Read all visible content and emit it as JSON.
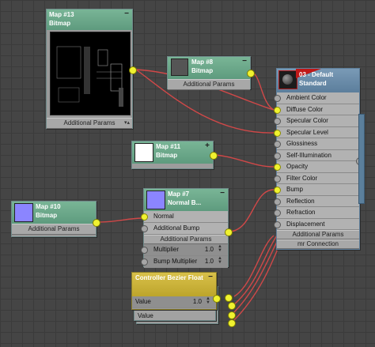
{
  "nodes": {
    "map13": {
      "title": "Map #13",
      "subtitle": "Bitmap",
      "footer": "Additional Params",
      "collapse": "−"
    },
    "map8": {
      "title": "Map #8",
      "subtitle": "Bitmap",
      "footer": "Additional Params",
      "collapse": "−"
    },
    "map11": {
      "title": "Map #11",
      "subtitle": "Bitmap",
      "collapse": "+"
    },
    "map10": {
      "title": "Map #10",
      "subtitle": "Bitmap",
      "footer": "Additional Params"
    },
    "map7": {
      "title": "Map #7",
      "subtitle": "Normal B...",
      "collapse": "−",
      "rows": [
        "Normal",
        "Additional Bump"
      ],
      "section": "Additional Params",
      "params": [
        {
          "label": "Multiplier",
          "value": "1.0"
        },
        {
          "label": "Bump Multiplier",
          "value": "1.0"
        }
      ]
    },
    "standard": {
      "title": "03 - Default",
      "subtitle": "Standard",
      "slots": [
        "Ambient Color",
        "Diffuse Color",
        "Specular Color",
        "Specular Level",
        "Glossiness",
        "Self-Illumination",
        "Opacity",
        "Filter Color",
        "Bump",
        "Reflection",
        "Refraction",
        "Displacement"
      ],
      "footer1": "Additional Params",
      "footer2": "mr Connection"
    },
    "controller": {
      "title": "Controller",
      "subtitle": "Bezier Float",
      "collapse": "−",
      "param": {
        "label": "Value",
        "value": "1.0"
      },
      "hidden_label": "Value"
    }
  },
  "colors": {
    "wire": "#d04848",
    "socket_active": "#f0f230",
    "node_header": "#6aa888",
    "controller_header": "#cbb33a"
  },
  "icons": [
    "collapse-icon",
    "expand-icon",
    "spinner-icon",
    "output-socket-icon",
    "input-socket-icon"
  ]
}
